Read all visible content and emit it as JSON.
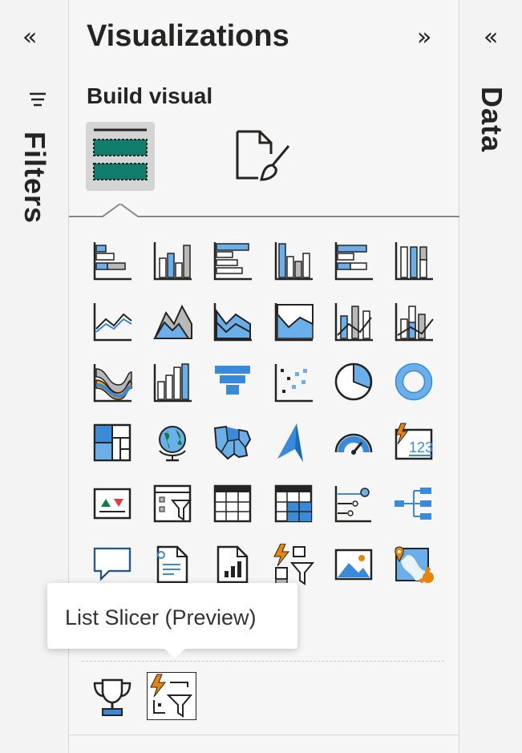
{
  "filters_pane": {
    "label": "Filters",
    "collapse_icon": "double-chevron-left-icon"
  },
  "visualizations_pane": {
    "title": "Visualizations",
    "expand_icon": "double-chevron-right-icon",
    "build_label": "Build visual",
    "tabs": [
      {
        "icon": "build-visual-fields-icon",
        "selected": true
      },
      {
        "icon": "format-visual-paintbrush-icon",
        "selected": false
      }
    ],
    "visual_icons": [
      "stacked-bar-chart",
      "stacked-column-chart",
      "clustered-bar-chart",
      "clustered-column-chart",
      "100-stacked-bar-chart",
      "100-stacked-column-chart",
      "line-chart",
      "area-chart",
      "stacked-area-chart",
      "100-stacked-area-chart",
      "line-and-stacked-column-chart",
      "line-and-clustered-column-chart",
      "ribbon-chart",
      "waterfall-chart",
      "funnel-chart",
      "scatter-chart",
      "pie-chart",
      "donut-chart",
      "treemap",
      "map",
      "filled-map",
      "azure-map",
      "gauge",
      "card-new",
      "kpi",
      "slicer",
      "table",
      "matrix",
      "key-influencers",
      "decomposition-tree",
      "qa-visual",
      "smart-narrative",
      "paginated-report",
      "button-slicer",
      "image",
      "arcgis-map"
    ],
    "other_visuals": [
      "trophy-goals-icon",
      "list-slicer-preview-icon"
    ],
    "tooltip": "List Slicer (Preview)"
  },
  "data_pane": {
    "label": "Data",
    "collapse_icon": "double-chevron-left-icon"
  },
  "colors": {
    "accent_blue": "#3b8ad9",
    "fill_blue": "#6aaeea",
    "gray": "#b8b8b8",
    "dark": "#252423",
    "orange": "#e8830c",
    "green": "#107c41"
  }
}
